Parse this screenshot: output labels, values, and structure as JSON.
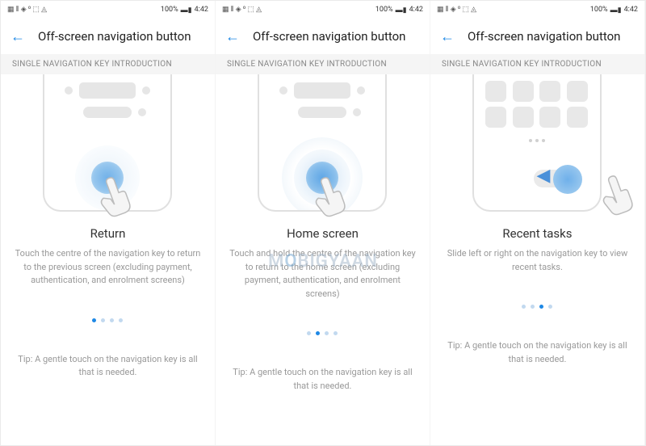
{
  "status": {
    "left_icons": "▦ ⫴ ◈ ⁰ ⬚ ◬",
    "battery_text": "100%",
    "time": "4:42"
  },
  "header": {
    "back_arrow": "←",
    "title": "Off-screen navigation button"
  },
  "section_label": "SINGLE NAVIGATION KEY INTRODUCTION",
  "pages": [
    {
      "title": "Return",
      "description": "Touch the centre of the navigation key to return to the previous screen (excluding payment, authentication, and enrolment screens)",
      "tip": "Tip: A gentle touch on the navigation key is all that is needed.",
      "active_dot": 0
    },
    {
      "title": "Home screen",
      "description": "Touch and hold the centre of the navigation key to return to the home screen (excluding payment, authentication, and enrolment screens)",
      "tip": "Tip: A gentle touch on the navigation key is all that is needed.",
      "active_dot": 1
    },
    {
      "title": "Recent tasks",
      "description": "Slide left or right on the navigation key to view recent tasks.",
      "tip": "Tip: A gentle touch on the navigation key is all that is needed.",
      "active_dot": 2
    }
  ],
  "swipe_arrow": "◀",
  "watermark": "MOBIGYAAN"
}
